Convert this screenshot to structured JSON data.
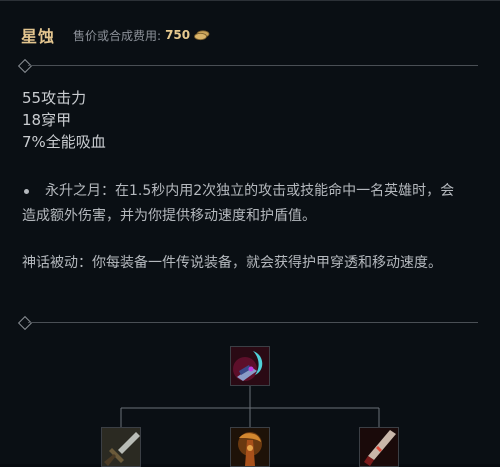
{
  "item": {
    "name": "星蚀",
    "cost_label": "售价或合成费用:",
    "cost_value": "750",
    "gold_icon": "gold-coins-icon"
  },
  "stats": [
    "55攻击力",
    "18穿甲",
    "7%全能吸血"
  ],
  "passive": {
    "text": "永升之月：在1.5秒内用2次独立的攻击或技能命中一名英雄时，会造成额外伤害，并为你提供移动速度和护盾值。"
  },
  "mythic": {
    "text": "神话被动：你每装备一件传说装备，就会获得护甲穿透和移动速度。"
  },
  "recipe": {
    "result_icon": "eclipse-item-icon",
    "components": [
      "long-sword-icon",
      "serrated-dirk-icon",
      "caulfields-warhammer-icon"
    ]
  },
  "colors": {
    "name": "#e3c58f",
    "cost": "#e6c98f",
    "text": "#b4b8bd",
    "background": "#0a0f14"
  }
}
